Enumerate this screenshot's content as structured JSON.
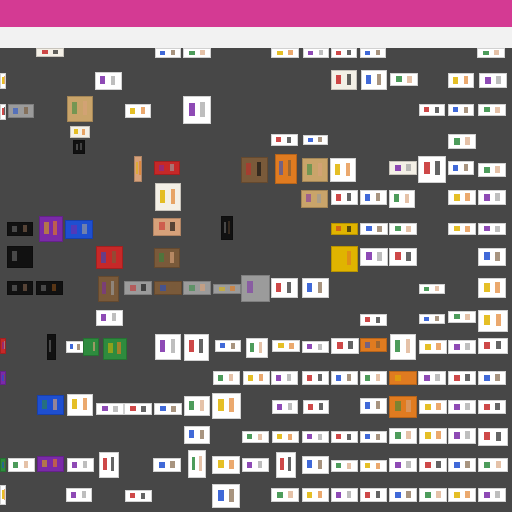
{
  "app": {
    "topbar_color": "#d43a93",
    "toolbar_color": "#f2f2f2",
    "canvas_color": "#474747"
  },
  "thumbnails": {
    "description_count_visible": "many",
    "palette": {
      "white": "#ffffff",
      "light": "#f4f0e6",
      "dark": "#111111",
      "tan": "#c9a46a",
      "brown": "#7a5a3a",
      "skin": "#d7a17a",
      "yellow": "#e0b400",
      "gray": "#9b9b9b",
      "red": "#c62828",
      "blue": "#1e4fd1",
      "green": "#2e8b3e",
      "purple": "#7a2aa8",
      "orange": "#e07b20"
    }
  }
}
